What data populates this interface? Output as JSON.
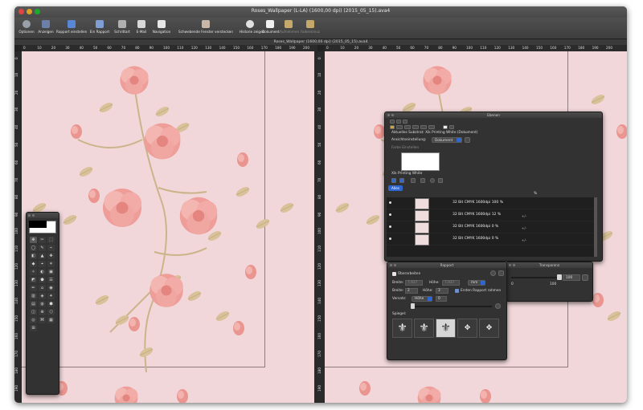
{
  "window": {
    "title": "Roses_Wallpaper (L-LA) (1600,00 dpi) (2015_05_15).ava4",
    "doc_title": "Roses_Wallpaper (1600,00 dpi) (2015_05_15).ava4"
  },
  "toolbar": {
    "items": [
      {
        "label": "Optionen",
        "icon": "gear-icon"
      },
      {
        "label": "Anzeigen",
        "icon": "display-icon"
      },
      {
        "label": "Rapport einstellen",
        "icon": "pattern-icon"
      },
      {
        "label": "Ein Rapport",
        "icon": "single-repeat-icon"
      },
      {
        "label": "Schrittart",
        "icon": "step-icon"
      },
      {
        "label": "E-Mail",
        "icon": "mail-icon"
      },
      {
        "label": "Navigation",
        "icon": "navigation-icon"
      },
      {
        "label": "Schwebende Fenster verstecken",
        "icon": "hide-windows-icon"
      },
      {
        "label": "Historie zeigen",
        "icon": "history-icon"
      },
      {
        "label": "Dokument",
        "icon": "document-icon"
      },
      {
        "label": "Aufnehmen",
        "icon": "record-icon"
      },
      {
        "label": "Fadenkreuz",
        "icon": "crosshair-icon"
      }
    ]
  },
  "ruler": {
    "top_left": [
      "0",
      "10",
      "20",
      "30",
      "40",
      "50",
      "60",
      "70",
      "80",
      "90",
      "100",
      "110",
      "120",
      "130",
      "140",
      "150",
      "160",
      "170",
      "180",
      "190",
      "200"
    ],
    "top_right": [
      "0",
      "10",
      "20",
      "30",
      "40",
      "50",
      "60",
      "70",
      "80",
      "90",
      "100",
      "110",
      "120",
      "130",
      "140",
      "150",
      "160",
      "170",
      "180",
      "190",
      "200"
    ],
    "side": [
      "0",
      "10",
      "20",
      "30",
      "40",
      "50",
      "60",
      "70",
      "80",
      "90",
      "100",
      "110",
      "120",
      "130",
      "140",
      "150",
      "160",
      "170",
      "180",
      "190",
      "200"
    ]
  },
  "ebenen": {
    "title": "Ebenen",
    "substrate": "Aktuelles Substrat: Xik Printing White (Dokument)",
    "ansicht_label": "Ansichtseinstellung:",
    "ansicht_value": "Dokument",
    "farbe_label": "Farbe Einstellen",
    "ink_label": "Xik Printing White",
    "alles_label": "Alles",
    "percent_label": "%",
    "layers": [
      {
        "name": "32 Bit CMYK 1600dpi 100 %",
        "sub": ""
      },
      {
        "name": "32 Bit CMYK 1600dpi 12 %",
        "sub": "+/-"
      },
      {
        "name": "32 Bit CMYK 1600dpi 0 %",
        "sub": "+/-"
      },
      {
        "name": "32 Bit CMYK 1600dpi 0 %",
        "sub": "+/-"
      }
    ]
  },
  "rapport": {
    "title": "Rapport",
    "ueberarbeiten": "Überarbeiten",
    "breite_label": "Breite:",
    "breite_value": "7,937",
    "hoehe_label": "Höhe:",
    "hoehe_value": "7,937",
    "unit": "mm",
    "breite2_label": "Breite:",
    "breite2_value": "2",
    "hoehe2_label": "Höhe:",
    "hoehe2_value": "3",
    "ersten_label": "Ersten Rapport rahmen",
    "versatz_label": "Versatz:",
    "versatz_value": "Höhe",
    "versatz_num": "0",
    "spiegel_label": "Spiegel:"
  },
  "transparenz": {
    "title": "Transparenz",
    "min": "0",
    "value": "100",
    "max": "100",
    "slider_fraction": 1.0
  },
  "tools": {
    "color_fg": "#000000",
    "color_bg": "#ffffff"
  },
  "colors": {
    "canvas_bg": "#f1d7da",
    "accent": "#2f66d0"
  }
}
